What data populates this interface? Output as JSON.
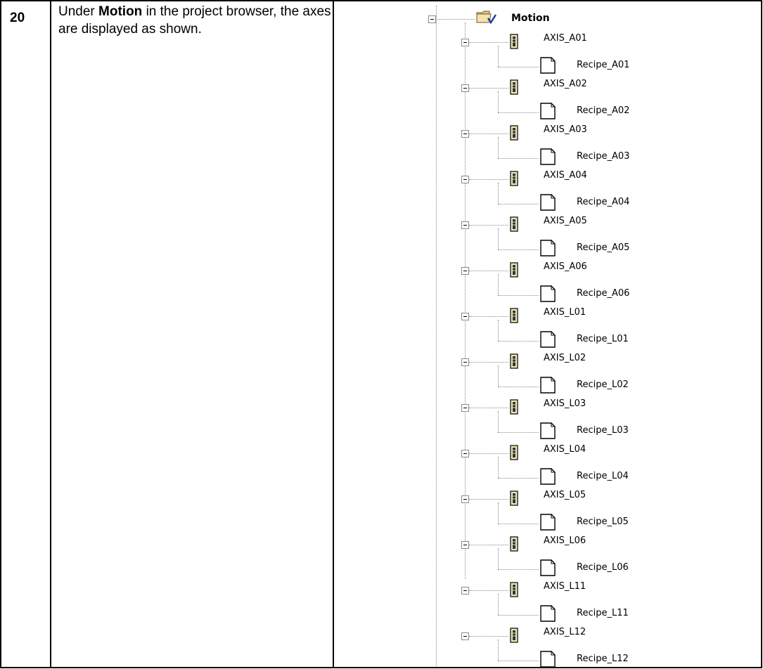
{
  "step": {
    "number": "20",
    "text_before": "Under ",
    "text_bold": "Motion",
    "text_after": " in the project browser, the axes are displayed as shown."
  },
  "tree": {
    "root_label": "Motion",
    "items": [
      {
        "axis": "AXIS_A01",
        "recipe": "Recipe_A01"
      },
      {
        "axis": "AXIS_A02",
        "recipe": "Recipe_A02"
      },
      {
        "axis": "AXIS_A03",
        "recipe": "Recipe_A03"
      },
      {
        "axis": "AXIS_A04",
        "recipe": "Recipe_A04"
      },
      {
        "axis": "AXIS_A05",
        "recipe": "Recipe_A05"
      },
      {
        "axis": "AXIS_A06",
        "recipe": "Recipe_A06"
      },
      {
        "axis": "AXIS_L01",
        "recipe": "Recipe_L01"
      },
      {
        "axis": "AXIS_L02",
        "recipe": "Recipe_L02"
      },
      {
        "axis": "AXIS_L03",
        "recipe": "Recipe_L03"
      },
      {
        "axis": "AXIS_L04",
        "recipe": "Recipe_L04"
      },
      {
        "axis": "AXIS_L05",
        "recipe": "Recipe_L05"
      },
      {
        "axis": "AXIS_L06",
        "recipe": "Recipe_L06"
      },
      {
        "axis": "AXIS_L11",
        "recipe": "Recipe_L11"
      },
      {
        "axis": "AXIS_L12",
        "recipe": "Recipe_L12"
      }
    ]
  }
}
